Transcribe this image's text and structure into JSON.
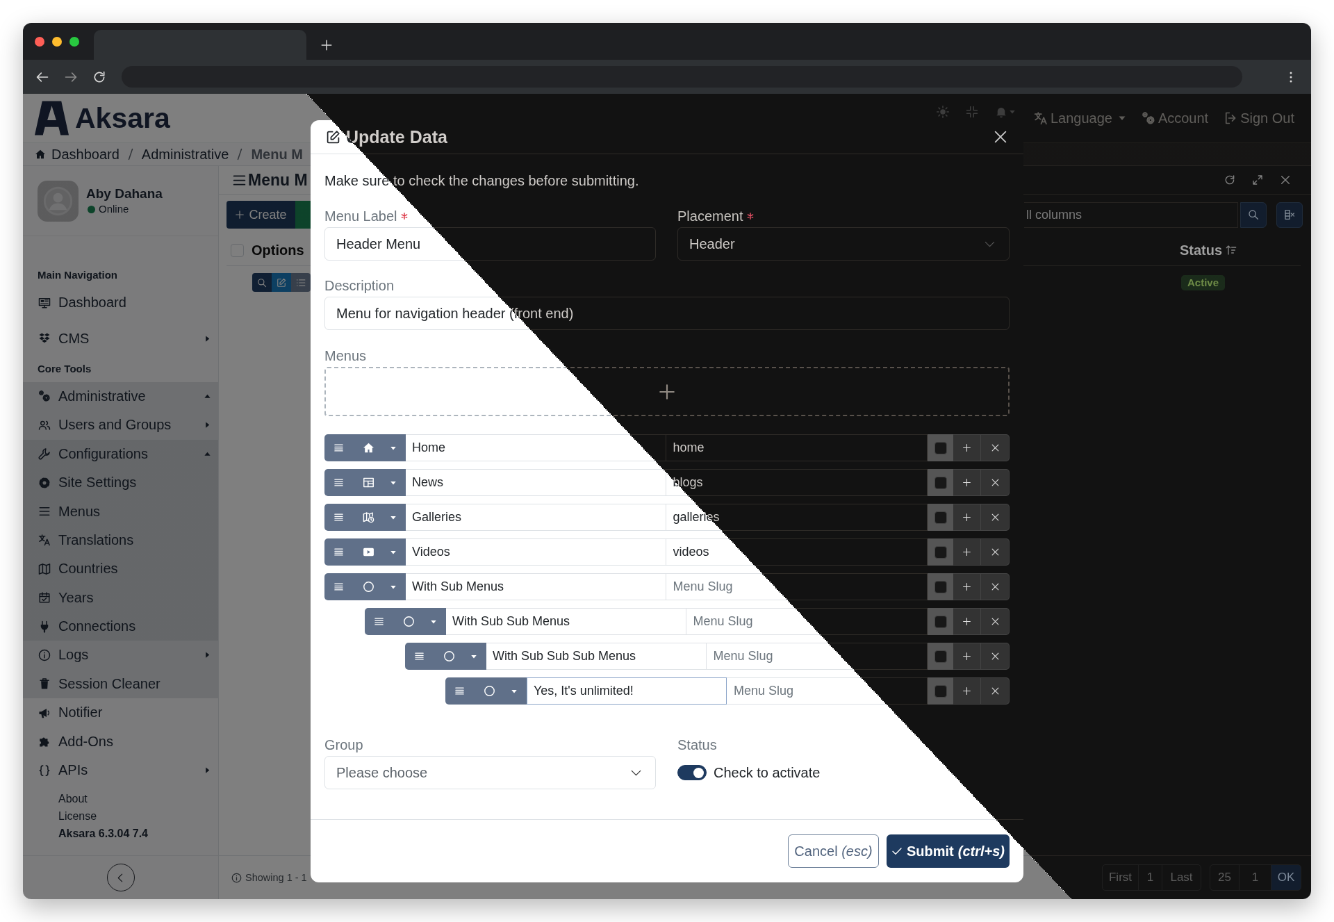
{
  "header": {
    "logo": "Aksara",
    "menu": [
      {
        "label": "Language",
        "dropdown": true
      },
      {
        "label": "Account",
        "dropdown": false
      },
      {
        "label": "Sign Out",
        "dropdown": false
      }
    ]
  },
  "breadcrumb": [
    {
      "label": "Dashboard",
      "current": false
    },
    {
      "label": "Administrative",
      "current": false
    },
    {
      "label": "Menu M",
      "current": true
    }
  ],
  "sidebar": {
    "user": {
      "name": "Aby Dahana",
      "status": "Online",
      "online": true
    },
    "sections": [
      {
        "title": "Main Navigation",
        "items": [
          {
            "label": "Dashboard"
          },
          {
            "label": "CMS",
            "expanded": false
          }
        ]
      },
      {
        "title": "Core Tools",
        "items": [
          {
            "label": "Administrative",
            "expanded": true,
            "children": [
              {
                "label": "Users and Groups",
                "expanded": false
              },
              {
                "label": "Configurations",
                "expanded": true,
                "children": [
                  {
                    "label": "Site Settings"
                  },
                  {
                    "label": "Menus"
                  },
                  {
                    "label": "Translations"
                  },
                  {
                    "label": "Countries"
                  },
                  {
                    "label": "Years"
                  },
                  {
                    "label": "Connections"
                  }
                ]
              },
              {
                "label": "Logs",
                "expanded": false
              },
              {
                "label": "Session Cleaner"
              }
            ]
          },
          {
            "label": "Notifier"
          },
          {
            "label": "Add-Ons"
          },
          {
            "label": "APIs",
            "expanded": false
          }
        ]
      }
    ],
    "links": [
      "About",
      "License"
    ],
    "version": "Aksara 6.3.04 7.4"
  },
  "panel": {
    "title": "Menu M",
    "create_button": "Create",
    "search": {
      "placeholder": "ll columns"
    },
    "table": {
      "select_all": {
        "checked": false
      },
      "columns": [
        {
          "label": "Options",
          "sortable": false
        },
        {
          "label": "Status",
          "sortable": true
        }
      ],
      "rows": [
        {
          "status": "Active"
        }
      ]
    },
    "footer": {
      "summary": "Showing 1 - 1",
      "pagination": [
        "First",
        "1",
        "Last"
      ],
      "per_page": "25",
      "page": "1",
      "go_button": "OK"
    }
  },
  "modal": {
    "title": "Update Data",
    "intro": "Make sure to check the changes before submitting.",
    "menu_label": {
      "label": "Menu Label",
      "required": true,
      "value": "Header Menu"
    },
    "placement": {
      "label": "Placement",
      "required": true,
      "value": "Header"
    },
    "description": {
      "label": "Description",
      "value": "Menu for navigation header (front end)"
    },
    "menus": {
      "label": "Menus",
      "items": [
        {
          "label": "Home",
          "slug": {
            "value": "home"
          },
          "checked": false,
          "focused": false
        },
        {
          "label": "News",
          "slug": {
            "value": "blogs"
          },
          "checked": false,
          "focused": false
        },
        {
          "label": "Galleries",
          "slug": {
            "value": "galleries"
          },
          "checked": false,
          "focused": false
        },
        {
          "label": "Videos",
          "slug": {
            "value": "videos"
          },
          "checked": false,
          "focused": false
        },
        {
          "label": "With Sub Menus",
          "slug": {
            "placeholder": "Menu Slug"
          },
          "checked": false,
          "focused": false,
          "children": [
            {
              "label": "With Sub Sub Menus",
              "slug": {
                "placeholder": "Menu Slug"
              },
              "checked": false,
              "focused": false,
              "children": [
                {
                  "label": "With Sub Sub Sub Menus",
                  "slug": {
                    "placeholder": "Menu Slug"
                  },
                  "checked": false,
                  "focused": false,
                  "children": [
                    {
                      "label": "Yes, It's unlimited!",
                      "slug": {
                        "placeholder": "Menu Slug"
                      },
                      "checked": false,
                      "focused": true
                    }
                  ]
                }
              ]
            }
          ]
        }
      ]
    },
    "group": {
      "label": "Group",
      "placeholder": "Please choose"
    },
    "status": {
      "label": "Status",
      "toggle_label": "Check to activate",
      "on": true
    },
    "buttons": {
      "cancel": "Cancel *(esc)*",
      "submit": "Submit *(ctrl+s)*"
    }
  }
}
